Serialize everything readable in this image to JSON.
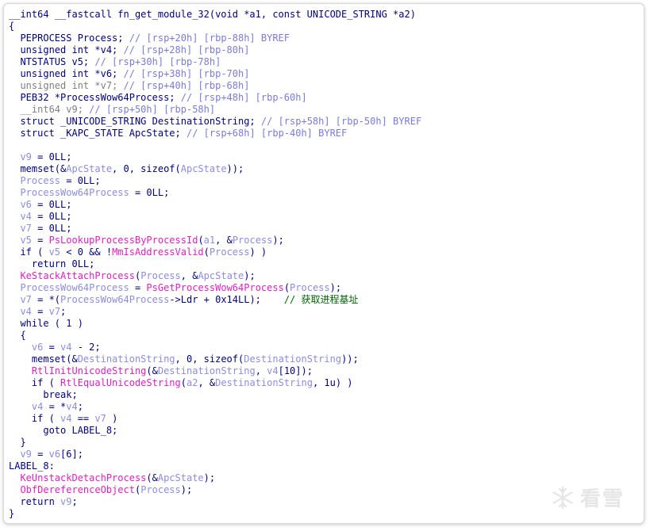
{
  "code_lines": [
    [
      {
        "t": "__int64 __fastcall fn_get_module_32(void *a1, const UNICODE_STRING *a2)",
        "c": "k"
      }
    ],
    [
      {
        "t": "{",
        "c": "k"
      }
    ],
    [
      {
        "t": "  PEPROCESS Process; ",
        "c": "k"
      },
      {
        "t": "// [rsp+20h] [rbp-88h] BYREF",
        "c": "c"
      }
    ],
    [
      {
        "t": "  unsigned int *v4; ",
        "c": "k"
      },
      {
        "t": "// [rsp+28h] [rbp-80h]",
        "c": "c"
      }
    ],
    [
      {
        "t": "  NTSTATUS v5; ",
        "c": "k"
      },
      {
        "t": "// [rsp+30h] [rbp-78h]",
        "c": "c"
      }
    ],
    [
      {
        "t": "  unsigned int *v6; ",
        "c": "k"
      },
      {
        "t": "// [rsp+38h] [rbp-70h]",
        "c": "c"
      }
    ],
    [
      {
        "t": "  unsigned int *v7; ",
        "c": "g"
      },
      {
        "t": "// [rsp+40h] [rbp-68h]",
        "c": "c"
      }
    ],
    [
      {
        "t": "  PEB32 *ProcessWow64Process; ",
        "c": "k"
      },
      {
        "t": "// [rsp+48h] [rbp-60h]",
        "c": "c"
      }
    ],
    [
      {
        "t": "  __int64 v9; ",
        "c": "g"
      },
      {
        "t": "// [rsp+50h] [rbp-58h]",
        "c": "c"
      }
    ],
    [
      {
        "t": "  struct _UNICODE_STRING DestinationString; ",
        "c": "k"
      },
      {
        "t": "// [rsp+58h] [rbp-50h] BYREF",
        "c": "c"
      }
    ],
    [
      {
        "t": "  struct _KAPC_STATE ApcState; ",
        "c": "k"
      },
      {
        "t": "// [rsp+68h] [rbp-40h] BYREF",
        "c": "c"
      }
    ],
    [],
    [
      {
        "t": "  ",
        "c": "k"
      },
      {
        "t": "v9",
        "c": "v"
      },
      {
        "t": " = 0LL;",
        "c": "k"
      }
    ],
    [
      {
        "t": "  memset(&",
        "c": "k"
      },
      {
        "t": "ApcState",
        "c": "v"
      },
      {
        "t": ", 0, sizeof(",
        "c": "k"
      },
      {
        "t": "ApcState",
        "c": "v"
      },
      {
        "t": "));",
        "c": "k"
      }
    ],
    [
      {
        "t": "  ",
        "c": "k"
      },
      {
        "t": "Process",
        "c": "v"
      },
      {
        "t": " = 0LL;",
        "c": "k"
      }
    ],
    [
      {
        "t": "  ",
        "c": "k"
      },
      {
        "t": "ProcessWow64Process",
        "c": "v"
      },
      {
        "t": " = 0LL;",
        "c": "k"
      }
    ],
    [
      {
        "t": "  ",
        "c": "k"
      },
      {
        "t": "v6",
        "c": "v"
      },
      {
        "t": " = 0LL;",
        "c": "k"
      }
    ],
    [
      {
        "t": "  ",
        "c": "k"
      },
      {
        "t": "v4",
        "c": "v"
      },
      {
        "t": " = 0LL;",
        "c": "k"
      }
    ],
    [
      {
        "t": "  ",
        "c": "k"
      },
      {
        "t": "v7",
        "c": "v"
      },
      {
        "t": " = 0LL;",
        "c": "k"
      }
    ],
    [
      {
        "t": "  ",
        "c": "k"
      },
      {
        "t": "v5",
        "c": "v"
      },
      {
        "t": " = ",
        "c": "k"
      },
      {
        "t": "PsLookupProcessByProcessId",
        "c": "f"
      },
      {
        "t": "(",
        "c": "k"
      },
      {
        "t": "a1",
        "c": "v"
      },
      {
        "t": ", &",
        "c": "k"
      },
      {
        "t": "Process",
        "c": "v"
      },
      {
        "t": ");",
        "c": "k"
      }
    ],
    [
      {
        "t": "  if ( ",
        "c": "k"
      },
      {
        "t": "v5",
        "c": "v"
      },
      {
        "t": " < 0 && !",
        "c": "k"
      },
      {
        "t": "MmIsAddressValid",
        "c": "f"
      },
      {
        "t": "(",
        "c": "k"
      },
      {
        "t": "Process",
        "c": "v"
      },
      {
        "t": ") )",
        "c": "k"
      }
    ],
    [
      {
        "t": "    return 0LL;",
        "c": "k"
      }
    ],
    [
      {
        "t": "  ",
        "c": "k"
      },
      {
        "t": "KeStackAttachProcess",
        "c": "f"
      },
      {
        "t": "(",
        "c": "k"
      },
      {
        "t": "Process",
        "c": "v"
      },
      {
        "t": ", &",
        "c": "k"
      },
      {
        "t": "ApcState",
        "c": "v"
      },
      {
        "t": ");",
        "c": "k"
      }
    ],
    [
      {
        "t": "  ",
        "c": "k"
      },
      {
        "t": "ProcessWow64Process",
        "c": "v"
      },
      {
        "t": " = ",
        "c": "k"
      },
      {
        "t": "PsGetProcessWow64Process",
        "c": "f"
      },
      {
        "t": "(",
        "c": "k"
      },
      {
        "t": "Process",
        "c": "v"
      },
      {
        "t": ");",
        "c": "k"
      }
    ],
    [
      {
        "t": "  ",
        "c": "k"
      },
      {
        "t": "v7",
        "c": "v"
      },
      {
        "t": " = *(",
        "c": "k"
      },
      {
        "t": "ProcessWow64Process",
        "c": "v"
      },
      {
        "t": "->Ldr + 0x14LL);    ",
        "c": "k"
      },
      {
        "t": "// 获取进程基址",
        "c": "cm"
      }
    ],
    [
      {
        "t": "  ",
        "c": "k"
      },
      {
        "t": "v4",
        "c": "v"
      },
      {
        "t": " = ",
        "c": "k"
      },
      {
        "t": "v7",
        "c": "v"
      },
      {
        "t": ";",
        "c": "k"
      }
    ],
    [
      {
        "t": "  while ( 1 )",
        "c": "k"
      }
    ],
    [
      {
        "t": "  {",
        "c": "k"
      }
    ],
    [
      {
        "t": "    ",
        "c": "k"
      },
      {
        "t": "v6",
        "c": "v"
      },
      {
        "t": " = ",
        "c": "k"
      },
      {
        "t": "v4",
        "c": "v"
      },
      {
        "t": " - 2;",
        "c": "k"
      }
    ],
    [
      {
        "t": "    memset(&",
        "c": "k"
      },
      {
        "t": "DestinationString",
        "c": "v"
      },
      {
        "t": ", 0, sizeof(",
        "c": "k"
      },
      {
        "t": "DestinationString",
        "c": "v"
      },
      {
        "t": "));",
        "c": "k"
      }
    ],
    [
      {
        "t": "    ",
        "c": "k"
      },
      {
        "t": "RtlInitUnicodeString",
        "c": "f"
      },
      {
        "t": "(&",
        "c": "k"
      },
      {
        "t": "DestinationString",
        "c": "v"
      },
      {
        "t": ", ",
        "c": "k"
      },
      {
        "t": "v4",
        "c": "v"
      },
      {
        "t": "[10]);",
        "c": "k"
      }
    ],
    [
      {
        "t": "    if ( ",
        "c": "k"
      },
      {
        "t": "RtlEqualUnicodeString",
        "c": "f"
      },
      {
        "t": "(",
        "c": "k"
      },
      {
        "t": "a2",
        "c": "v"
      },
      {
        "t": ", &",
        "c": "k"
      },
      {
        "t": "DestinationString",
        "c": "v"
      },
      {
        "t": ", 1u) )",
        "c": "k"
      }
    ],
    [
      {
        "t": "      break;",
        "c": "k"
      }
    ],
    [
      {
        "t": "    ",
        "c": "k"
      },
      {
        "t": "v4",
        "c": "v"
      },
      {
        "t": " = *",
        "c": "k"
      },
      {
        "t": "v4",
        "c": "v"
      },
      {
        "t": ";",
        "c": "k"
      }
    ],
    [
      {
        "t": "    if ( ",
        "c": "k"
      },
      {
        "t": "v4",
        "c": "v"
      },
      {
        "t": " == ",
        "c": "k"
      },
      {
        "t": "v7",
        "c": "v"
      },
      {
        "t": " )",
        "c": "k"
      }
    ],
    [
      {
        "t": "      goto LABEL_8;",
        "c": "k"
      }
    ],
    [
      {
        "t": "  }",
        "c": "k"
      }
    ],
    [
      {
        "t": "  ",
        "c": "k"
      },
      {
        "t": "v9",
        "c": "v"
      },
      {
        "t": " = ",
        "c": "k"
      },
      {
        "t": "v6",
        "c": "v"
      },
      {
        "t": "[6];",
        "c": "k"
      }
    ],
    [
      {
        "t": "LABEL_8:",
        "c": "k"
      }
    ],
    [
      {
        "t": "  ",
        "c": "k"
      },
      {
        "t": "KeUnstackDetachProcess",
        "c": "f"
      },
      {
        "t": "(&",
        "c": "k"
      },
      {
        "t": "ApcState",
        "c": "v"
      },
      {
        "t": ");",
        "c": "k"
      }
    ],
    [
      {
        "t": "  ",
        "c": "k"
      },
      {
        "t": "ObfDereferenceObject",
        "c": "f"
      },
      {
        "t": "(",
        "c": "k"
      },
      {
        "t": "Process",
        "c": "v"
      },
      {
        "t": ");",
        "c": "k"
      }
    ],
    [
      {
        "t": "  return ",
        "c": "k"
      },
      {
        "t": "v9",
        "c": "v"
      },
      {
        "t": ";",
        "c": "k"
      }
    ],
    [
      {
        "t": "}",
        "c": "k"
      }
    ]
  ],
  "watermark": {
    "icon": "snowflake-icon",
    "text": "看雪"
  },
  "colors": {
    "keyword": "#000080",
    "comment": "#7b7bd6",
    "variable": "#8c8ce0",
    "function": "#e020c0",
    "chinese_comment": "#006400",
    "greyed": "#808080"
  }
}
